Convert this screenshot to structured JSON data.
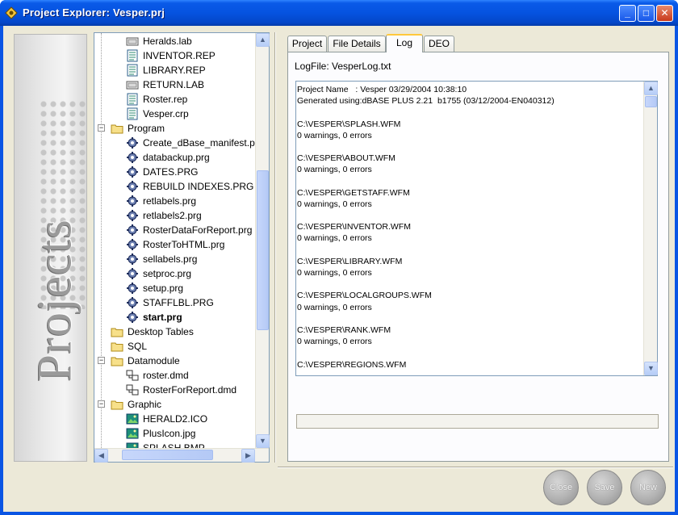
{
  "window": {
    "title": "Project Explorer: Vesper.prj",
    "minimize_label": "_",
    "maximize_label": "□",
    "close_label": "✕"
  },
  "banner": {
    "text": "Projects"
  },
  "tree": {
    "items": [
      {
        "label": "Heralds.lab",
        "icon": "label-file-icon",
        "level": 2
      },
      {
        "label": "INVENTOR.REP",
        "icon": "report-file-icon",
        "level": 2
      },
      {
        "label": "LIBRARY.REP",
        "icon": "report-file-icon",
        "level": 2
      },
      {
        "label": "RETURN.LAB",
        "icon": "label-file-icon",
        "level": 2
      },
      {
        "label": "Roster.rep",
        "icon": "report-file-icon",
        "level": 2
      },
      {
        "label": "Vesper.crp",
        "icon": "report-file-icon",
        "level": 2
      },
      {
        "label": "Program",
        "icon": "folder-icon",
        "level": 1,
        "expander": "−"
      },
      {
        "label": "Create_dBase_manifest.p",
        "icon": "program-file-icon",
        "level": 2
      },
      {
        "label": "databackup.prg",
        "icon": "program-file-icon",
        "level": 2
      },
      {
        "label": "DATES.PRG",
        "icon": "program-file-icon",
        "level": 2
      },
      {
        "label": "REBUILD INDEXES.PRG",
        "icon": "program-file-icon",
        "level": 2
      },
      {
        "label": "retlabels.prg",
        "icon": "program-file-icon",
        "level": 2
      },
      {
        "label": "retlabels2.prg",
        "icon": "program-file-icon",
        "level": 2
      },
      {
        "label": "RosterDataForReport.prg",
        "icon": "program-file-icon",
        "level": 2
      },
      {
        "label": "RosterToHTML.prg",
        "icon": "program-file-icon",
        "level": 2
      },
      {
        "label": "sellabels.prg",
        "icon": "program-file-icon",
        "level": 2
      },
      {
        "label": "setproc.prg",
        "icon": "program-file-icon",
        "level": 2
      },
      {
        "label": "setup.prg",
        "icon": "program-file-icon",
        "level": 2
      },
      {
        "label": "STAFFLBL.PRG",
        "icon": "program-file-icon",
        "level": 2
      },
      {
        "label": "start.prg",
        "icon": "program-file-icon",
        "level": 2,
        "selected": true
      },
      {
        "label": "Desktop Tables",
        "icon": "folder-icon",
        "level": 1
      },
      {
        "label": "SQL",
        "icon": "folder-icon",
        "level": 1
      },
      {
        "label": "Datamodule",
        "icon": "folder-icon",
        "level": 1,
        "expander": "−"
      },
      {
        "label": "roster.dmd",
        "icon": "datamodule-file-icon",
        "level": 2
      },
      {
        "label": "RosterForReport.dmd",
        "icon": "datamodule-file-icon",
        "level": 2
      },
      {
        "label": "Graphic",
        "icon": "folder-icon",
        "level": 1,
        "expander": "−"
      },
      {
        "label": "HERALD2.ICO",
        "icon": "image-file-icon",
        "level": 2
      },
      {
        "label": "PlusIcon.jpg",
        "icon": "image-file-icon",
        "level": 2
      },
      {
        "label": "SPLASH.BMP",
        "icon": "image-file-icon",
        "level": 2
      }
    ]
  },
  "tabs": [
    {
      "label": "Project",
      "active": false
    },
    {
      "label": "File Details",
      "active": false
    },
    {
      "label": "Log",
      "active": true
    },
    {
      "label": "DEO",
      "active": false
    }
  ],
  "log": {
    "logfile_label": "LogFile: VesperLog.txt",
    "lines": [
      "Project Name   : Vesper 03/29/2004 10:38:10",
      "Generated using:dBASE PLUS 2.21  b1755 (03/12/2004-EN040312)",
      "",
      "C:\\VESPER\\SPLASH.WFM",
      "0 warnings, 0 errors",
      "",
      "C:\\VESPER\\ABOUT.WFM",
      "0 warnings, 0 errors",
      "",
      "C:\\VESPER\\GETSTAFF.WFM",
      "0 warnings, 0 errors",
      "",
      "C:\\VESPER\\INVENTOR.WFM",
      "0 warnings, 0 errors",
      "",
      "C:\\VESPER\\LIBRARY.WFM",
      "0 warnings, 0 errors",
      "",
      "C:\\VESPER\\LOCALGROUPS.WFM",
      "0 warnings, 0 errors",
      "",
      "C:\\VESPER\\RANK.WFM",
      "0 warnings, 0 errors",
      "",
      "C:\\VESPER\\REGIONS.WFM"
    ]
  },
  "buttons": {
    "close": "Close",
    "save": "Save",
    "new": "New"
  },
  "colors": {
    "titlebar": "#0553e0",
    "client": "#ece9d8",
    "tab_highlight": "#ffc83c"
  }
}
